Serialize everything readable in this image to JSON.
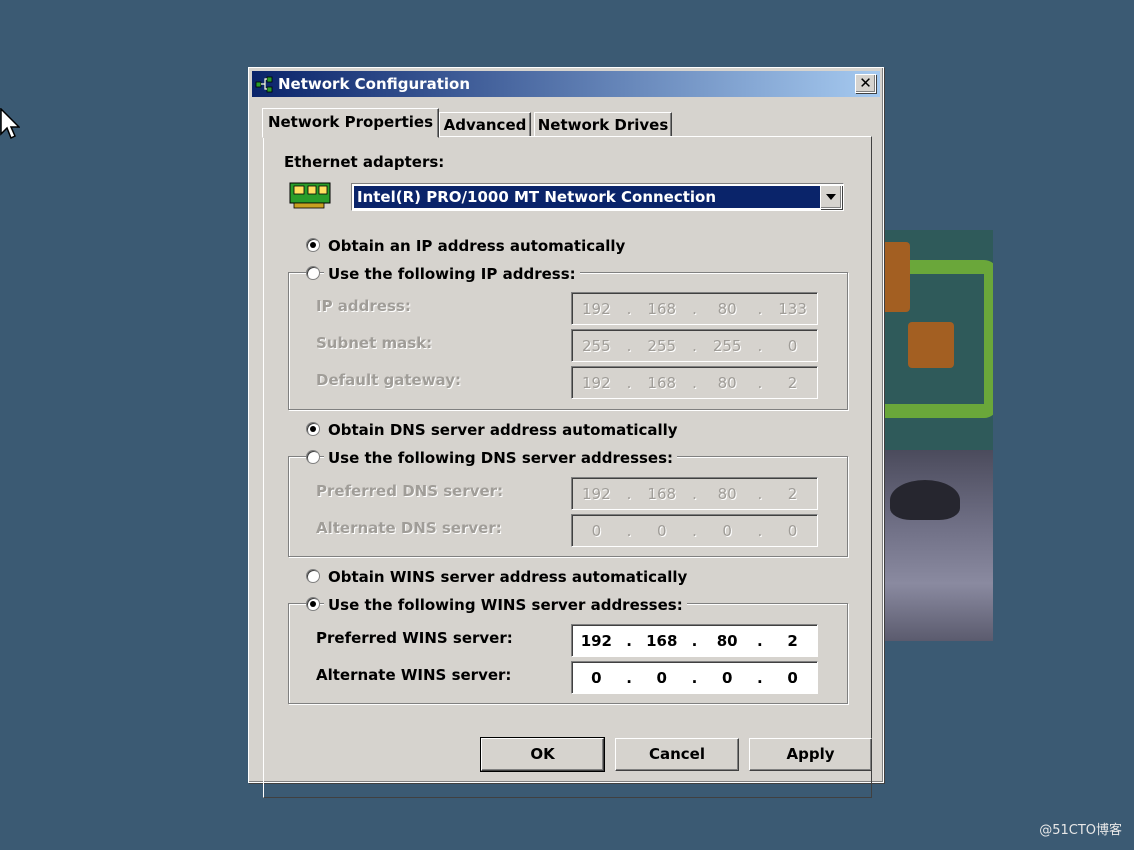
{
  "window": {
    "title": "Network Configuration"
  },
  "tabs": [
    {
      "label": "Network Properties",
      "active": true
    },
    {
      "label": "Advanced",
      "active": false
    },
    {
      "label": "Network Drives",
      "active": false
    }
  ],
  "adapters": {
    "label": "Ethernet adapters:",
    "selected": "Intel(R) PRO/1000 MT Network Connection"
  },
  "ip": {
    "auto_label": "Obtain an IP address automatically",
    "manual_label": "Use the following IP address:",
    "auto_selected": true,
    "fields": [
      {
        "label": "IP address:",
        "octets": [
          "192",
          "168",
          "80",
          "133"
        ]
      },
      {
        "label": "Subnet mask:",
        "octets": [
          "255",
          "255",
          "255",
          "0"
        ]
      },
      {
        "label": "Default gateway:",
        "octets": [
          "192",
          "168",
          "80",
          "2"
        ]
      }
    ]
  },
  "dns": {
    "auto_label": "Obtain DNS server address automatically",
    "manual_label": "Use the following DNS server addresses:",
    "auto_selected": true,
    "fields": [
      {
        "label": "Preferred DNS server:",
        "octets": [
          "192",
          "168",
          "80",
          "2"
        ]
      },
      {
        "label": "Alternate DNS server:",
        "octets": [
          "0",
          "0",
          "0",
          "0"
        ]
      }
    ]
  },
  "wins": {
    "auto_label": "Obtain WINS server address automatically",
    "manual_label": "Use the following WINS server addresses:",
    "auto_selected": false,
    "fields": [
      {
        "label": "Preferred WINS server:",
        "octets": [
          "192",
          "168",
          "80",
          "2"
        ]
      },
      {
        "label": "Alternate WINS server:",
        "octets": [
          "0",
          "0",
          "0",
          "0"
        ]
      }
    ]
  },
  "buttons": {
    "ok": "OK",
    "cancel": "Cancel",
    "apply": "Apply"
  },
  "watermark": "@51CTO博客",
  "colors": {
    "desktop": "#3b5a73",
    "titlebar_start": "#0a246a",
    "titlebar_end": "#a6caf0",
    "dialog": "#d6d3ce",
    "selection": "#0a246a"
  }
}
